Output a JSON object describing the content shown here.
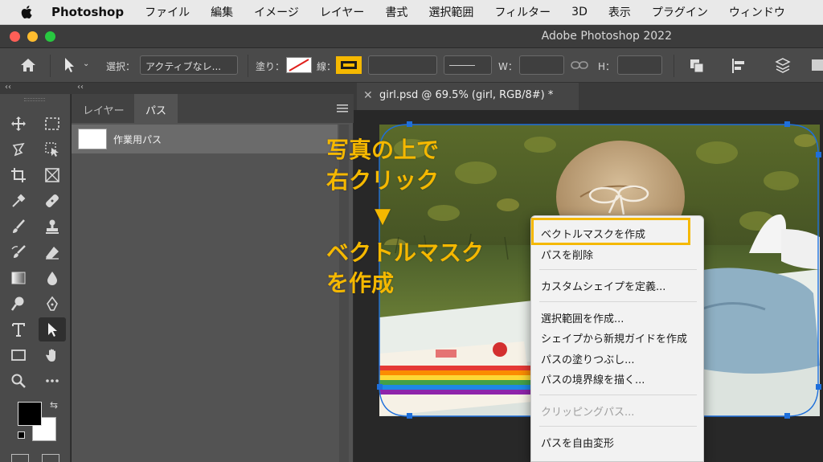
{
  "menubar": {
    "app_name": "Photoshop",
    "items": [
      "ファイル",
      "編集",
      "イメージ",
      "レイヤー",
      "書式",
      "選択範囲",
      "フィルター",
      "3D",
      "表示",
      "プラグイン",
      "ウィンドウ"
    ]
  },
  "window": {
    "title": "Adobe Photoshop 2022"
  },
  "options": {
    "select_label": "選択：",
    "select_value": "アクティブなレ...",
    "fill_label": "塗り：",
    "stroke_label": "線：",
    "w_label": "W：",
    "h_label": "H："
  },
  "panels": {
    "tabs": [
      "レイヤー",
      "パス"
    ],
    "active_tab": "パス",
    "path_name": "作業用パス"
  },
  "document": {
    "tab_title": "girl.psd @ 69.5% (girl, RGB/8#) *"
  },
  "annotation": {
    "line1": "写真の上で",
    "line2": "右クリック",
    "arrow": "▼",
    "line3": "ベクトルマスク",
    "line4": "を作成"
  },
  "context_menu": {
    "items": [
      {
        "label": "ベクトルマスクを作成",
        "highlighted": true
      },
      {
        "label": "パスを削除"
      },
      {
        "label": "カスタムシェイプを定義..."
      },
      {
        "label": "選択範囲を作成..."
      },
      {
        "label": "シェイプから新規ガイドを作成"
      },
      {
        "label": "パスの塗りつぶし..."
      },
      {
        "label": "パスの境界線を描く..."
      },
      {
        "label": "クリッピングパス...",
        "disabled": true
      },
      {
        "label": "パスを自由変形"
      }
    ]
  },
  "colors": {
    "highlight": "#f5b800",
    "selection": "#1e6fdb",
    "annotation": "#f5b800"
  }
}
